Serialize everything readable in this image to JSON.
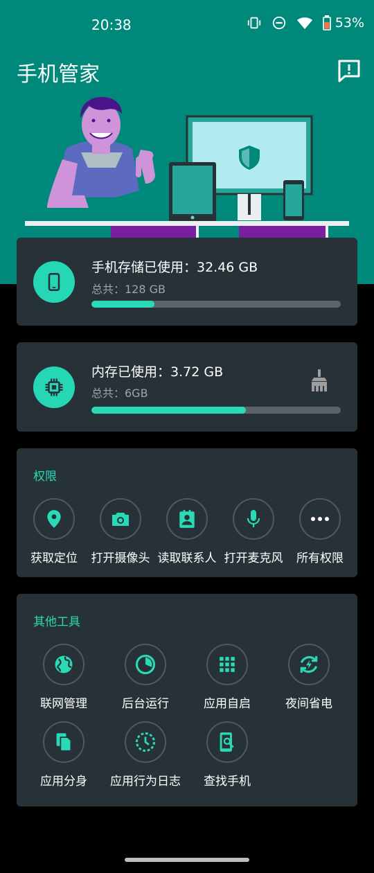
{
  "status_bar": {
    "time": "20:38",
    "battery": "53%"
  },
  "header": {
    "title": "手机管家"
  },
  "storage": {
    "title": "手机存储已使用：32.46 GB",
    "total": "总共：128 GB",
    "used_fraction": 0.2536
  },
  "memory": {
    "title": "内存已使用：3.72 GB",
    "total": "总共：6GB",
    "used_fraction": 0.62
  },
  "permissions": {
    "title": "权限",
    "items": [
      {
        "label": "获取定位",
        "icon": "location-icon"
      },
      {
        "label": "打开摄像头",
        "icon": "camera-icon"
      },
      {
        "label": "读取联系人",
        "icon": "contacts-icon"
      },
      {
        "label": "打开麦克风",
        "icon": "microphone-icon"
      },
      {
        "label": "所有权限",
        "icon": "more-icon"
      }
    ]
  },
  "tools": {
    "title": "其他工具",
    "items": [
      {
        "label": "联网管理",
        "icon": "globe-icon"
      },
      {
        "label": "后台运行",
        "icon": "pie-icon"
      },
      {
        "label": "应用自启",
        "icon": "grid-icon"
      },
      {
        "label": "夜间省电",
        "icon": "power-cycle-icon"
      },
      {
        "label": "应用分身",
        "icon": "copy-icon"
      },
      {
        "label": "应用行为日志",
        "icon": "clock-icon"
      },
      {
        "label": "查找手机",
        "icon": "find-phone-icon"
      }
    ]
  },
  "colors": {
    "accent": "#2ad9b6",
    "header_bg": "#00897b",
    "card_bg": "#263238"
  }
}
